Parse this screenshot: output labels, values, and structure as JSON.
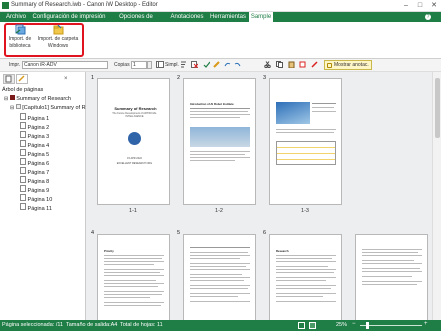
{
  "window": {
    "title": "Summary of Research.iwb - Canon iW Desktop - Editor",
    "minimize": "–",
    "maximize": "□",
    "close": "✕"
  },
  "ribbon": {
    "tabs": [
      "Archivo",
      "Configuración de impresión",
      "Opciones de impresión",
      "Anotaciones",
      "Herramientas",
      "Sample"
    ],
    "active_tab": "Sample",
    "buttons": [
      {
        "label_line1": "Import. de",
        "label_line2": "biblioteca",
        "icon": "import-library-icon"
      },
      {
        "label_line1": "Import. de carpeta",
        "label_line2": "Windows",
        "icon": "import-folder-icon"
      }
    ],
    "highlight_color": "#e0141e"
  },
  "toolbar": {
    "printer_label": "Impr.",
    "printer_value": "Canon iR-ADV",
    "copies_label": "Copias",
    "copies_value": "1",
    "mode_value": "Simpl.",
    "show_annotations": "Mostrar anotac."
  },
  "left_pane": {
    "tree_title": "Árbol de páginas",
    "items": [
      {
        "label": "Summary of Research",
        "level": 0
      },
      {
        "label": "[Capítulo1] Summary of R",
        "level": 1
      },
      {
        "label": "Página 1",
        "level": 2
      },
      {
        "label": "Página 2",
        "level": 2
      },
      {
        "label": "Página 3",
        "level": 2
      },
      {
        "label": "Página 4",
        "level": 2
      },
      {
        "label": "Página 5",
        "level": 2
      },
      {
        "label": "Página 6",
        "level": 2
      },
      {
        "label": "Página 7",
        "level": 2
      },
      {
        "label": "Página 8",
        "level": 2
      },
      {
        "label": "Página 9",
        "level": 2
      },
      {
        "label": "Página 10",
        "level": 2
      },
      {
        "label": "Página 11",
        "level": 2
      }
    ]
  },
  "thumbnails": [
    {
      "num": "1",
      "label": "1-1",
      "title": "Summary of Research",
      "subtitle": "The Future Development of ARTIFICIAL INTELLIGENCE",
      "date": "15 APR 2022",
      "org": "EXCELLENT RESEARCH ORG"
    },
    {
      "num": "2",
      "label": "1-2",
      "title": "Introduction of AI Robot Institute"
    },
    {
      "num": "3",
      "label": "1-3"
    },
    {
      "num": "4",
      "label": "",
      "title": "Priority"
    },
    {
      "num": "5",
      "label": ""
    },
    {
      "num": "6",
      "label": "",
      "title": "Research"
    }
  ],
  "status": {
    "selected": "Página seleccionada: /11",
    "output_size": "Tamaño de salida:A4",
    "total": "Total de hojas: 11",
    "zoom": "25%"
  },
  "colors": {
    "brand_green": "#1f7d46",
    "accent_red": "#e0141e"
  }
}
